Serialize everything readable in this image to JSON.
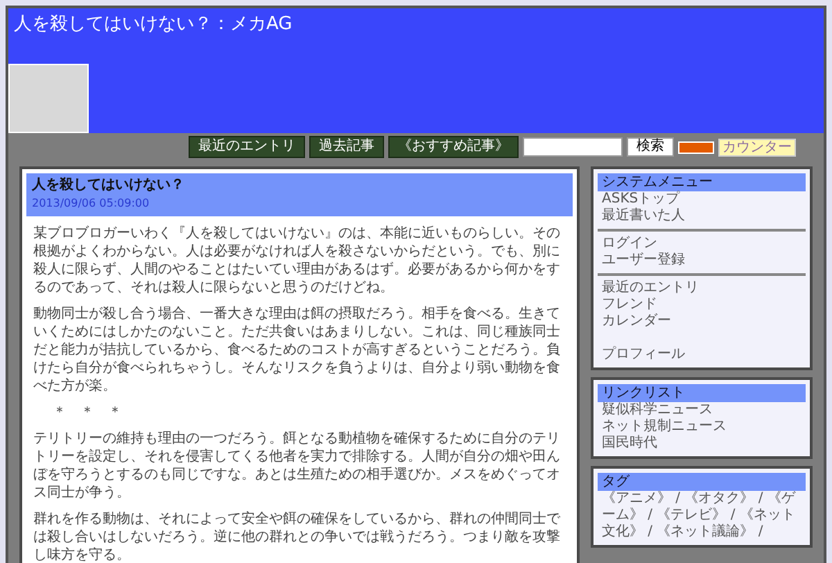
{
  "blog": {
    "title": "人を殺してはいけない？：メカAG"
  },
  "nav": {
    "links": [
      "最近のエントリ",
      "過去記事",
      "《おすすめ記事》"
    ],
    "search": {
      "button": "検索"
    },
    "counter_badge": "カウンター"
  },
  "post": {
    "title": "人を殺してはいけない？",
    "date": "2013/09/06 05:09:00",
    "paragraphs": [
      {
        "kind": "text",
        "text": "某ブロブロガーいわく『人を殺してはいけない』のは、本能に近いものらしい。その根拠がよくわからない。人は必要がなければ人を殺さないからだという。でも、別に殺人に限らず、人間のやることはたいてい理由があるはず。必要があるから何かをするのであって、それは殺人に限らないと思うのだけどね。"
      },
      {
        "kind": "text",
        "text": "動物同士が殺し合う場合、一番大きな理由は餌の摂取だろう。相手を食べる。生きていくためにはしかたのないこと。ただ共食いはあまりしない。これは、同じ種族同士だと能力が拮抗しているから、食べるためのコストが高すぎるということだろう。負けたら自分が食べられちゃうし。そんなリスクを負うよりは、自分より弱い動物を食べた方が楽。"
      },
      {
        "kind": "separator",
        "text": "＊　＊　＊"
      },
      {
        "kind": "text",
        "text": "テリトリーの維持も理由の一つだろう。餌となる動植物を確保するために自分のテリトリーを設定し、それを侵害してくる他者を実力で排除する。人間が自分の畑や田んぼを守ろうとするのも同じですな。あとは生殖ための相手選びか。メスをめぐってオス同士が争う。"
      },
      {
        "kind": "text",
        "text": "群れを作る動物は、それによって安全や餌の確保をしているから、群れの仲間同士では殺し合いはしないだろう。逆に他の群れとの争いでは戦うだろう。つまり敵を攻撃し味方を守る。"
      }
    ]
  },
  "sidebar": {
    "panels": [
      {
        "title": "システムメニュー",
        "items": [
          {
            "kind": "link",
            "text": "ASKSトップ"
          },
          {
            "kind": "link",
            "text": "最近書いた人"
          },
          {
            "kind": "divider"
          },
          {
            "kind": "link",
            "text": "ログイン"
          },
          {
            "kind": "link",
            "text": "ユーザー登録"
          },
          {
            "kind": "divider"
          },
          {
            "kind": "link",
            "text": "最近のエントリ"
          },
          {
            "kind": "link",
            "text": "フレンド"
          },
          {
            "kind": "link",
            "text": "カレンダー"
          },
          {
            "kind": "spacer"
          },
          {
            "kind": "link",
            "text": "プロフィール"
          }
        ]
      },
      {
        "title": "リンクリスト",
        "items": [
          {
            "kind": "link",
            "text": "疑似科学ニュース"
          },
          {
            "kind": "link",
            "text": "ネット規制ニュース"
          },
          {
            "kind": "link",
            "text": "国民時代"
          }
        ]
      },
      {
        "title": "タグ",
        "items": [
          {
            "kind": "tags",
            "text": "《アニメ》 / 《オタク》 / 《ゲーム》 / 《テレビ》 / 《ネット文化》 / 《ネット議論》 /"
          }
        ]
      }
    ]
  }
}
